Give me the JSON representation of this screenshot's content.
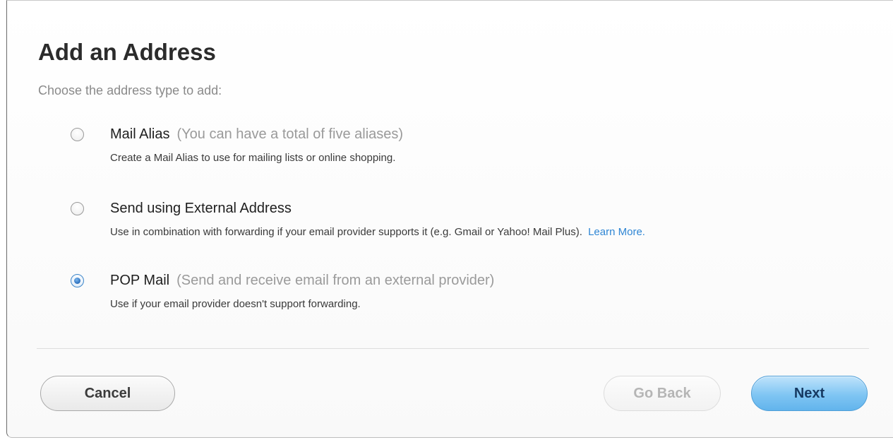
{
  "dialog": {
    "title": "Add an Address",
    "subtitle": "Choose the address type to add:"
  },
  "options": [
    {
      "label": "Mail Alias",
      "note": "(You can have a total of five aliases)",
      "description": "Create a Mail Alias to use for mailing lists or online shopping.",
      "selected": false
    },
    {
      "label": "Send using External Address",
      "note": "",
      "description": "Use in combination with forwarding if your email provider supports it (e.g. Gmail or Yahoo! Mail Plus).",
      "link": "Learn More.",
      "selected": false
    },
    {
      "label": "POP Mail",
      "note": "(Send and receive email from an external provider)",
      "description": "Use if your email provider doesn't support forwarding.",
      "selected": true
    }
  ],
  "buttons": {
    "cancel": "Cancel",
    "back": "Go Back",
    "next": "Next"
  },
  "colors": {
    "accent": "#2f86d4",
    "next_button": "#7fc5f3",
    "title_text": "#2b2b2b",
    "muted_text": "#9a9a9a"
  },
  "icons": {
    "unchecked_radio": "radio-unchecked-icon",
    "checked_radio": "radio-checked-icon"
  }
}
